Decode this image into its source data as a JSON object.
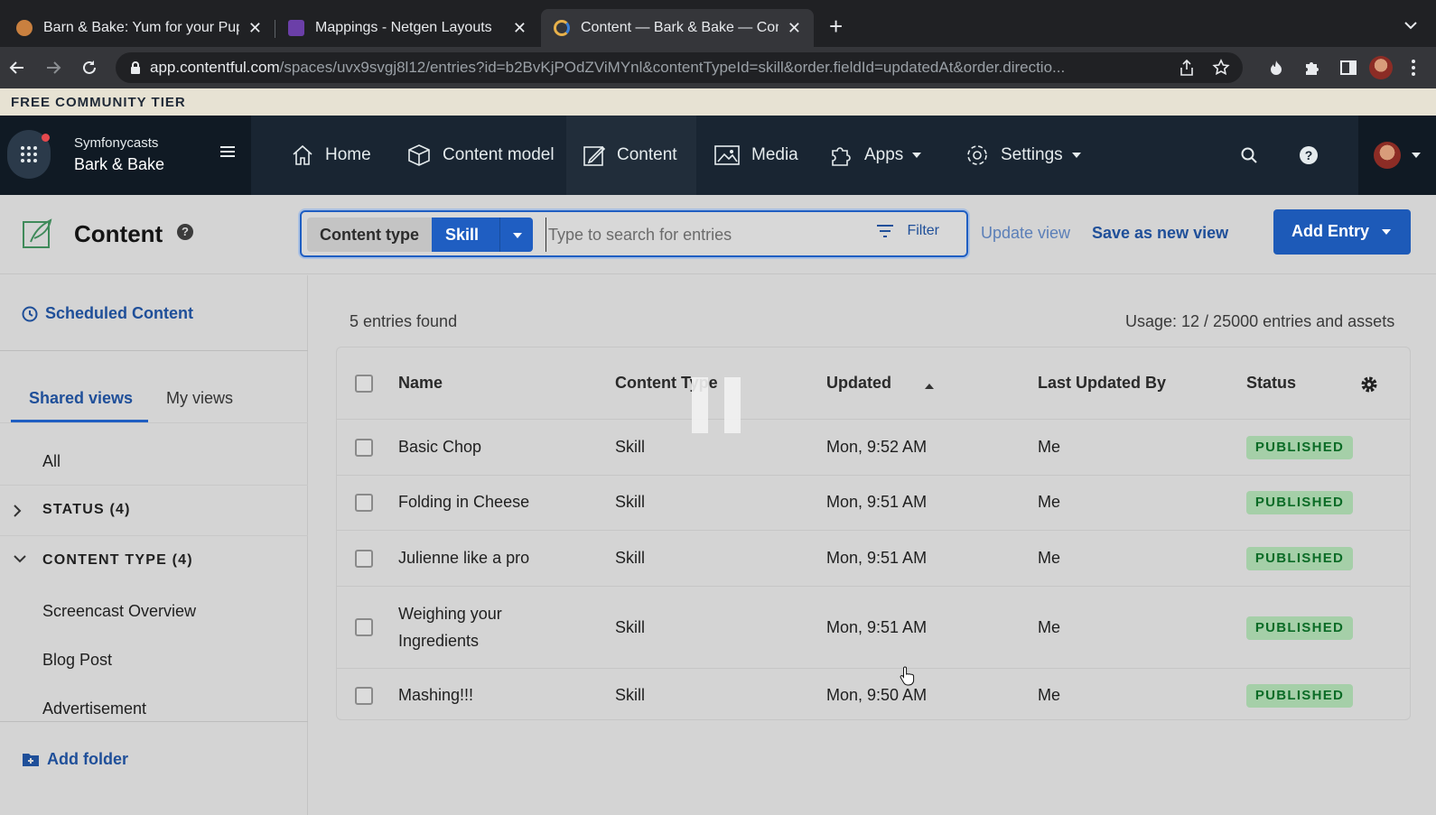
{
  "browser": {
    "tabs": [
      {
        "title": "Barn & Bake: Yum for your Pup"
      },
      {
        "title": "Mappings - Netgen Layouts"
      },
      {
        "title": "Content — Bark & Bake — Cont"
      }
    ],
    "url_host": "app.contentful.com",
    "url_path": "/spaces/uvx9svgj8l12/entries?id=b2BvKjPOdZViMYnl&contentTypeId=skill&order.fieldId=updatedAt&order.directio..."
  },
  "tier_banner": "FREE COMMUNITY TIER",
  "space": {
    "org": "Symfonycasts",
    "name": "Bark & Bake"
  },
  "nav": {
    "home": "Home",
    "content_model": "Content model",
    "content": "Content",
    "media": "Media",
    "apps": "Apps",
    "settings": "Settings"
  },
  "header": {
    "title": "Content",
    "help": "?",
    "content_type_label": "Content type",
    "content_type_value": "Skill",
    "search_placeholder": "Type to search for entries",
    "filter_label": "Filter",
    "update_view": "Update view",
    "save_view": "Save as new view",
    "add_entry": "Add Entry"
  },
  "sidebar": {
    "scheduled": "Scheduled Content",
    "tabs": [
      "Shared views",
      "My views"
    ],
    "all": "All",
    "folders": [
      {
        "label": "STATUS (4)",
        "expanded": false
      },
      {
        "label": "CONTENT TYPE (4)",
        "expanded": true
      }
    ],
    "content_type_items": [
      "Screencast Overview",
      "Blog Post",
      "Advertisement"
    ],
    "add_folder": "Add folder"
  },
  "list": {
    "found": "5 entries found",
    "usage": "Usage: 12 / 25000 entries and assets",
    "columns": [
      "Name",
      "Content Type",
      "Updated",
      "Last Updated By",
      "Status"
    ],
    "rows": [
      {
        "name": "Basic Chop",
        "type": "Skill",
        "updated": "Mon, 9:52 AM",
        "by": "Me",
        "status": "PUBLISHED"
      },
      {
        "name": "Folding in Cheese",
        "type": "Skill",
        "updated": "Mon, 9:51 AM",
        "by": "Me",
        "status": "PUBLISHED"
      },
      {
        "name": "Julienne like a pro",
        "type": "Skill",
        "updated": "Mon, 9:51 AM",
        "by": "Me",
        "status": "PUBLISHED"
      },
      {
        "name": "Weighing your",
        "name2": "Ingredients",
        "type": "Skill",
        "updated": "Mon, 9:51 AM",
        "by": "Me",
        "status": "PUBLISHED"
      },
      {
        "name": "Mashing!!!",
        "type": "Skill",
        "updated": "Mon, 9:50 AM",
        "by": "Me",
        "status": "PUBLISHED"
      }
    ]
  },
  "icons": {
    "nav": [
      "home-icon",
      "content-model-icon",
      "content-icon",
      "media-icon",
      "apps-icon",
      "settings-icon"
    ],
    "utility": [
      "search-icon",
      "help-icon",
      "gear-icon",
      "pause-icon",
      "pointer-cursor-icon"
    ]
  },
  "colors": {
    "primary": "#1d5ab8",
    "nav_bg": "#192532",
    "published_bg": "#a5cfa8",
    "published_text": "#0b6b26"
  }
}
